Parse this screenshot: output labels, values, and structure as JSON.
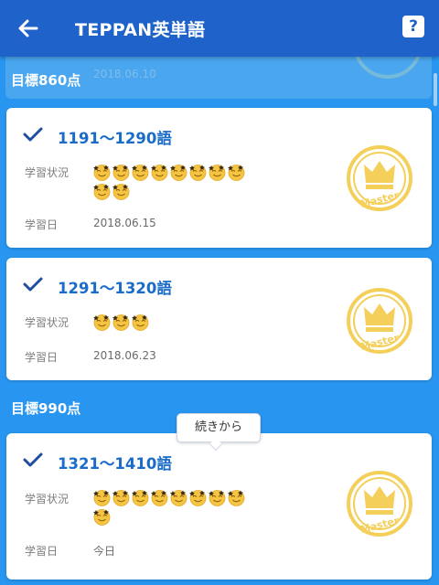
{
  "app_bar": {
    "title": "TEPPAN英単語",
    "help_label": "?"
  },
  "partial_card": {
    "date": "2018.06.10"
  },
  "sections": [
    {
      "title": "目標860点"
    },
    {
      "title": "目標990点"
    }
  ],
  "labels": {
    "status": "学習状況",
    "date": "学習日"
  },
  "cards": [
    {
      "range": "1191〜1290語",
      "date": "2018.06.15",
      "stars": 10,
      "completed": true,
      "medal_text": "Master"
    },
    {
      "range": "1291〜1320語",
      "date": "2018.06.23",
      "stars": 3,
      "completed": true,
      "medal_text": "Master"
    },
    {
      "range": "1321〜1410語",
      "date": "今日",
      "stars": 9,
      "completed": true,
      "medal_text": "Master"
    }
  ],
  "tooltip": {
    "text": "続きから"
  },
  "colors": {
    "app_bar": "#1f62c9",
    "background": "#2896f0",
    "accent": "#1a6cc8",
    "medal": "#f4cf5a",
    "star_face": "#f5c542"
  },
  "icons": {
    "back": "arrow-left-icon",
    "help": "help-icon",
    "check": "check-icon",
    "medal": "crown-medal-icon",
    "star": "smiley-star-icon"
  }
}
